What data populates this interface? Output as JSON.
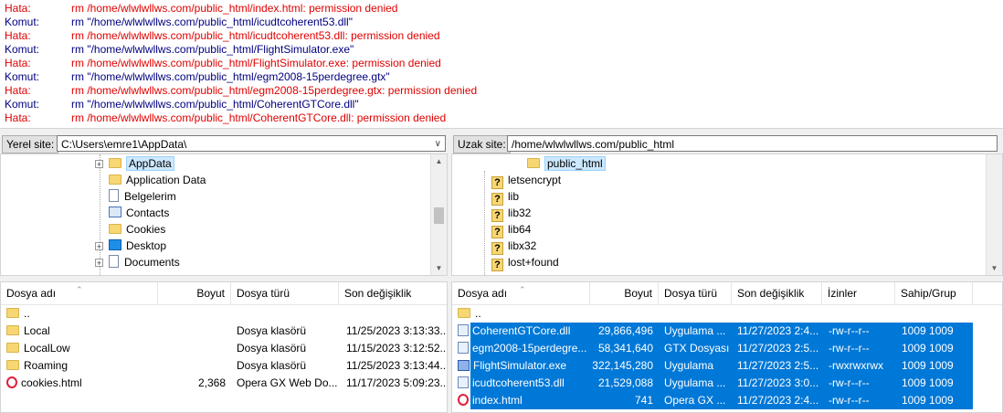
{
  "log": [
    {
      "label": "Hata:",
      "type": "error",
      "text": "rm /home/wlwlwllws.com/public_html/index.html: permission denied"
    },
    {
      "label": "Komut:",
      "type": "command",
      "text": "rm \"/home/wlwlwllws.com/public_html/icudtcoherent53.dll\""
    },
    {
      "label": "Hata:",
      "type": "error",
      "text": "rm /home/wlwlwllws.com/public_html/icudtcoherent53.dll: permission denied"
    },
    {
      "label": "Komut:",
      "type": "command",
      "text": "rm \"/home/wlwlwllws.com/public_html/FlightSimulator.exe\""
    },
    {
      "label": "Hata:",
      "type": "error",
      "text": "rm /home/wlwlwllws.com/public_html/FlightSimulator.exe: permission denied"
    },
    {
      "label": "Komut:",
      "type": "command",
      "text": "rm \"/home/wlwlwllws.com/public_html/egm2008-15perdegree.gtx\""
    },
    {
      "label": "Hata:",
      "type": "error",
      "text": "rm /home/wlwlwllws.com/public_html/egm2008-15perdegree.gtx: permission denied"
    },
    {
      "label": "Komut:",
      "type": "command",
      "text": "rm \"/home/wlwlwllws.com/public_html/CoherentGTCore.dll\""
    },
    {
      "label": "Hata:",
      "type": "error",
      "text": "rm /home/wlwlwllws.com/public_html/CoherentGTCore.dll: permission denied"
    }
  ],
  "local": {
    "site_label": "Yerel site:",
    "path": "C:\\Users\\emre1\\AppData\\",
    "tree": [
      {
        "label": "AppData",
        "icon": "folder-icon",
        "expander": true,
        "selected": true
      },
      {
        "label": "Application Data",
        "icon": "folder-icon",
        "expander": false
      },
      {
        "label": "Belgelerim",
        "icon": "document-icon",
        "expander": false
      },
      {
        "label": "Contacts",
        "icon": "contacts-icon",
        "expander": false
      },
      {
        "label": "Cookies",
        "icon": "folder-icon",
        "expander": false
      },
      {
        "label": "Desktop",
        "icon": "desktop-icon",
        "expander": true
      },
      {
        "label": "Documents",
        "icon": "document-icon",
        "expander": true
      }
    ],
    "headers": {
      "name": "Dosya adı",
      "size": "Boyut",
      "type": "Dosya türü",
      "modified": "Son değişiklik"
    },
    "files": [
      {
        "name": "..",
        "size": "",
        "type": "",
        "modified": "",
        "icon": "folder-icon"
      },
      {
        "name": "Local",
        "size": "",
        "type": "Dosya klasörü",
        "modified": "11/25/2023 3:13:33...",
        "icon": "folder-icon"
      },
      {
        "name": "LocalLow",
        "size": "",
        "type": "Dosya klasörü",
        "modified": "11/15/2023 3:12:52...",
        "icon": "folder-icon"
      },
      {
        "name": "Roaming",
        "size": "",
        "type": "Dosya klasörü",
        "modified": "11/25/2023 3:13:44...",
        "icon": "folder-icon"
      },
      {
        "name": "cookies.html",
        "size": "2,368",
        "type": "Opera GX Web Do...",
        "modified": "11/17/2023 5:09:23...",
        "icon": "opera-icon"
      }
    ]
  },
  "remote": {
    "site_label": "Uzak site:",
    "path": "/home/wlwlwllws.com/public_html",
    "tree": [
      {
        "label": "public_html",
        "icon": "folder-icon",
        "selected": true
      },
      {
        "label": "letsencrypt",
        "icon": "unknown-folder-icon"
      },
      {
        "label": "lib",
        "icon": "unknown-folder-icon"
      },
      {
        "label": "lib32",
        "icon": "unknown-folder-icon"
      },
      {
        "label": "lib64",
        "icon": "unknown-folder-icon"
      },
      {
        "label": "libx32",
        "icon": "unknown-folder-icon"
      },
      {
        "label": "lost+found",
        "icon": "unknown-folder-icon"
      }
    ],
    "headers": {
      "name": "Dosya adı",
      "size": "Boyut",
      "type": "Dosya türü",
      "modified": "Son değişiklik",
      "perms": "İzinler",
      "owner": "Sahip/Grup"
    },
    "files": [
      {
        "name": "..",
        "size": "",
        "type": "",
        "modified": "",
        "perms": "",
        "owner": "",
        "icon": "folder-icon",
        "selected": false
      },
      {
        "name": "CoherentGTCore.dll",
        "size": "29,866,496",
        "type": "Uygulama ...",
        "modified": "11/27/2023 2:4...",
        "perms": "-rw-r--r--",
        "owner": "1009 1009",
        "icon": "file-icon",
        "selected": true
      },
      {
        "name": "egm2008-15perdegre...",
        "size": "58,341,640",
        "type": "GTX Dosyası",
        "modified": "11/27/2023 2:5...",
        "perms": "-rw-r--r--",
        "owner": "1009 1009",
        "icon": "file-icon",
        "selected": true
      },
      {
        "name": "FlightSimulator.exe",
        "size": "322,145,280",
        "type": "Uygulama",
        "modified": "11/27/2023 2:5...",
        "perms": "-rwxrwxrwx",
        "owner": "1009 1009",
        "icon": "exe-icon",
        "selected": true
      },
      {
        "name": "icudtcoherent53.dll",
        "size": "21,529,088",
        "type": "Uygulama ...",
        "modified": "11/27/2023 3:0...",
        "perms": "-rw-r--r--",
        "owner": "1009 1009",
        "icon": "file-icon",
        "selected": true
      },
      {
        "name": "index.html",
        "size": "741",
        "type": "Opera GX ...",
        "modified": "11/27/2023 2:4...",
        "perms": "-rw-r--r--",
        "owner": "1009 1009",
        "icon": "opera-icon",
        "selected": true
      }
    ]
  },
  "colors": {
    "error": "#e00000",
    "command": "#000080",
    "selection": "#0078d7"
  }
}
